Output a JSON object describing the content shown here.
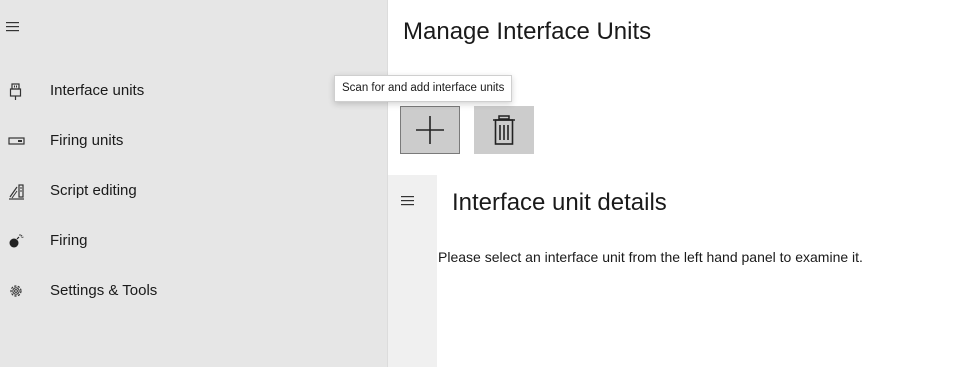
{
  "navigation": {
    "menu_icon": "hamburger-menu-icon",
    "items": [
      {
        "label": "Interface units",
        "icon": "usb-plug-icon"
      },
      {
        "label": "Firing units",
        "icon": "firing-unit-icon"
      },
      {
        "label": "Script editing",
        "icon": "script-edit-icon"
      },
      {
        "label": "Firing",
        "icon": "bomb-icon"
      },
      {
        "label": "Settings & Tools",
        "icon": "gear-icon"
      }
    ]
  },
  "main": {
    "title": "Manage Interface Units",
    "toolbar": {
      "add_tooltip": "Scan for and add interface units",
      "add_icon": "plus-icon",
      "delete_icon": "trash-icon"
    },
    "details": {
      "menu_icon": "hamburger-menu-icon",
      "title": "Interface unit details",
      "message": "Please select an interface unit from the left hand panel to examine it."
    }
  }
}
